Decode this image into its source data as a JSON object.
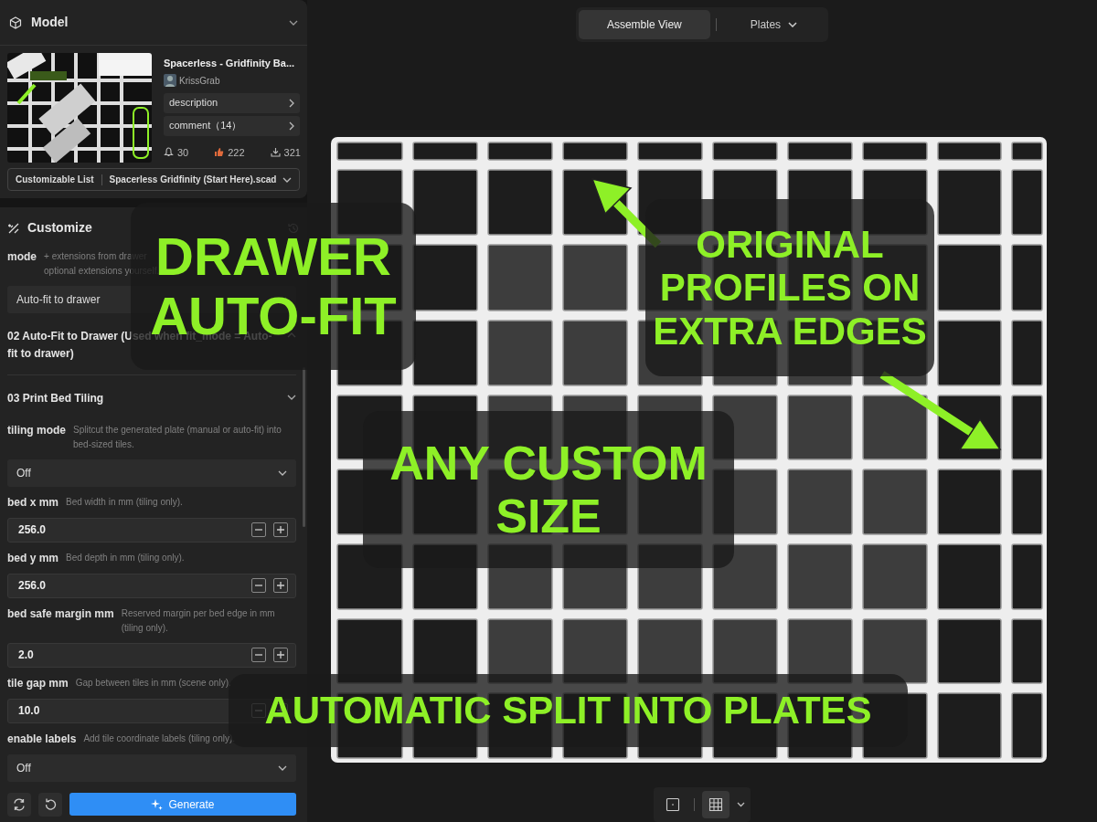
{
  "model_panel": {
    "title": "Model",
    "expanded": true,
    "name": "Spacerless - Gridfinity Ba...",
    "author": "KrissGrab",
    "links": [
      {
        "label": "description"
      },
      {
        "label": "comment（14）"
      }
    ],
    "stats": [
      {
        "kind": "boost",
        "value": "30"
      },
      {
        "kind": "like",
        "value": "222"
      },
      {
        "kind": "download",
        "value": "321"
      }
    ],
    "file_select": {
      "label": "Customizable List",
      "value": "Spacerless Gridfinity (Start Here).scad"
    }
  },
  "customize": {
    "title": "Customize",
    "items": [
      {
        "kind": "param",
        "label": "mode",
        "help_lines": [
          "+ extensions from drawer",
          "optional extensions yourself."
        ],
        "control": {
          "kind": "select",
          "value": "Auto-fit to drawer"
        }
      },
      {
        "kind": "section",
        "title": "02 Auto-Fit to Drawer (Used when fit_mode = Auto-fit to drawer)",
        "expanded": false
      },
      {
        "kind": "section",
        "title": "03 Print Bed Tiling",
        "expanded": true
      },
      {
        "kind": "param",
        "label": "tiling mode",
        "help_lines": [
          "Splitcut the generated plate (manual or auto-fit) into bed-sized tiles."
        ],
        "control": {
          "kind": "select",
          "value": "Off"
        }
      },
      {
        "kind": "param",
        "label": "bed x mm",
        "help_lines": [
          "Bed width in mm (tiling only)."
        ],
        "control": {
          "kind": "number",
          "value": "256.0"
        }
      },
      {
        "kind": "param",
        "label": "bed y mm",
        "help_lines": [
          "Bed depth in mm (tiling only)."
        ],
        "control": {
          "kind": "number",
          "value": "256.0"
        }
      },
      {
        "kind": "param",
        "label": "bed safe margin mm",
        "help_lines": [
          "Reserved margin per bed edge in mm (tiling only)."
        ],
        "control": {
          "kind": "number",
          "value": "2.0"
        }
      },
      {
        "kind": "param",
        "label": "tile gap mm",
        "help_lines": [
          "Gap between tiles in mm (scene only)."
        ],
        "control": {
          "kind": "number",
          "value": "10.0"
        }
      },
      {
        "kind": "param",
        "label": "enable labels",
        "help_lines": [
          "Add tile coordinate labels (tiling only)."
        ],
        "control": {
          "kind": "select",
          "value": "Off"
        }
      }
    ],
    "generate_label": "Generate"
  },
  "view_tabs": [
    {
      "label": "Assemble View",
      "selected": true,
      "dropdown": false
    },
    {
      "label": "Plates",
      "selected": false,
      "dropdown": true
    }
  ],
  "view_tools": [
    {
      "kind": "single",
      "selected": false
    },
    {
      "kind": "grid",
      "selected": true
    }
  ],
  "captions": [
    {
      "lines": [
        "DRAWER",
        "AUTO-FIT"
      ]
    },
    {
      "lines": [
        "ORIGINAL",
        "PROFILES ON",
        "EXTRA EDGES"
      ]
    },
    {
      "lines": [
        "ANY CUSTOM",
        "SIZE"
      ]
    },
    {
      "lines": [
        "AUTOMATIC SPLIT INTO PLATES"
      ]
    }
  ]
}
